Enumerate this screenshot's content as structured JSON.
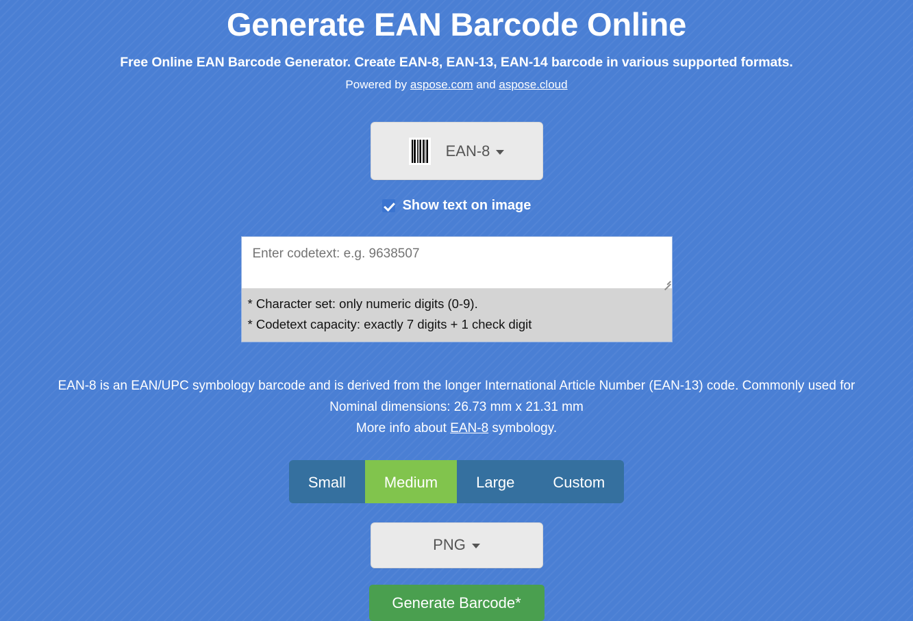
{
  "header": {
    "title": "Generate EAN Barcode Online",
    "subtitle": "Free Online EAN Barcode Generator. Create EAN-8, EAN-13, EAN-14 barcode in various supported formats.",
    "powered_prefix": "Powered by ",
    "powered_link1": "aspose.com",
    "powered_middle": " and ",
    "powered_link2": "aspose.cloud"
  },
  "symbology": {
    "icon": "barcode-icon",
    "selected": "EAN-8",
    "caret": "chevron-down-icon"
  },
  "show_text": {
    "label": "Show text on image",
    "checked": true
  },
  "codetext": {
    "placeholder": "Enter codetext: e.g. 9638507",
    "value": "",
    "hints": [
      "* Character set: only numeric digits (0-9).",
      "* Codetext capacity: exactly 7 digits + 1 check digit"
    ]
  },
  "description": {
    "line1": "EAN-8 is an EAN/UPC symbology barcode and is derived from the longer International Article Number (EAN-13) code. Commonly used for",
    "line2": "Nominal dimensions: 26.73 mm x 21.31 mm",
    "more_info_prefix": "More info about ",
    "more_info_link": "EAN-8",
    "more_info_suffix": " symbology."
  },
  "size_options": [
    {
      "label": "Small",
      "selected": false
    },
    {
      "label": "Medium",
      "selected": true
    },
    {
      "label": "Large",
      "selected": false
    },
    {
      "label": "Custom",
      "selected": false
    }
  ],
  "format": {
    "selected": "PNG",
    "caret": "chevron-down-icon"
  },
  "generate": {
    "label": "Generate Barcode*"
  },
  "colors": {
    "background": "#4a7fd4",
    "size_button": "#35709f",
    "size_button_active": "#81c44d",
    "generate_button": "#4a9f4f",
    "dropdown": "#eaeaea",
    "hint_box": "#d4d4d4"
  }
}
